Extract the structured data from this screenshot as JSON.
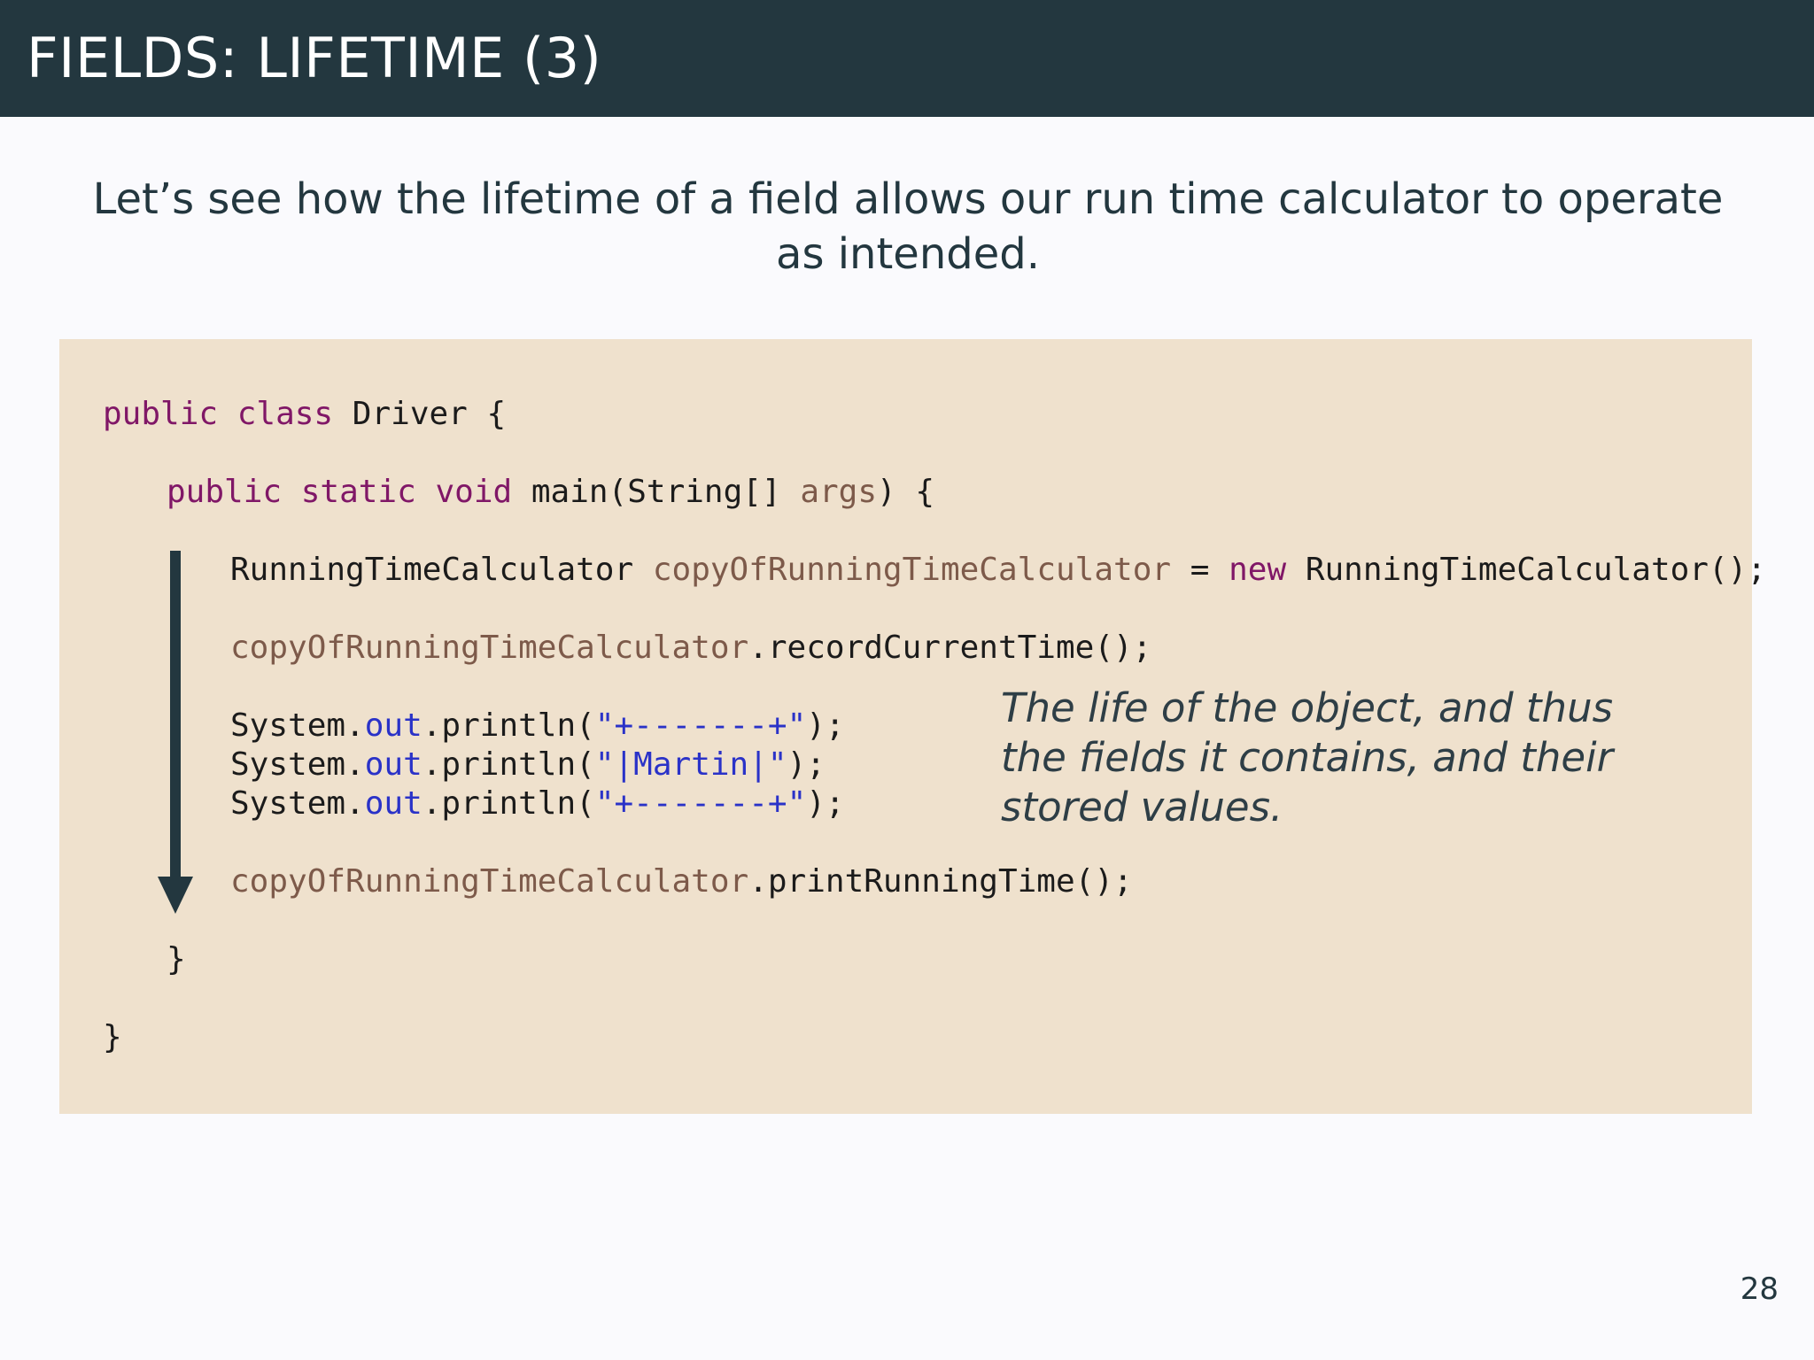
{
  "slide": {
    "title": "FIELDS: LIFETIME (3)",
    "subtitle": "Let’s see how the lifetime of a field allows our run time calculator to operate as intended.",
    "annotation": "The life of the object, and thus the fields it contains, and their stored values.",
    "page_number": "28"
  },
  "code": {
    "l1": {
      "kw1": "public",
      "kw2": "class",
      "name": "Driver",
      "brace": "{"
    },
    "l2": {
      "kw1": "public",
      "kw2": "static",
      "kw3": "void",
      "method": "main(String[]",
      "param": "args",
      "end": ") {"
    },
    "l3": {
      "type": "RunningTimeCalculator",
      "var": "copyOfRunningTimeCalculator",
      "eq": "=",
      "kw": "new",
      "ctor": "RunningTimeCalculator();"
    },
    "l4": {
      "var": "copyOfRunningTimeCalculator",
      "call": ".recordCurrentTime();"
    },
    "l5": {
      "sys": "System.",
      "out": "out",
      "call": ".println(",
      "str": "\"+-------+\"",
      "end": ");"
    },
    "l6": {
      "sys": "System.",
      "out": "out",
      "call": ".println(",
      "str": "\"|Martin|\"",
      "end": ");"
    },
    "l7": {
      "sys": "System.",
      "out": "out",
      "call": ".println(",
      "str": "\"+-------+\"",
      "end": ");"
    },
    "l8": {
      "var": "copyOfRunningTimeCalculator",
      "call": ".printRunningTime();"
    },
    "l9": {
      "brace": "}"
    },
    "l10": {
      "brace": "}"
    }
  },
  "colors": {
    "header_bg": "#23373f",
    "code_bg": "#efe1cd",
    "keyword": "#801767",
    "variable": "#7d5a4a",
    "field_and_string": "#2a32c8"
  },
  "icons": {
    "flow_arrow": "arrow-down-icon"
  }
}
